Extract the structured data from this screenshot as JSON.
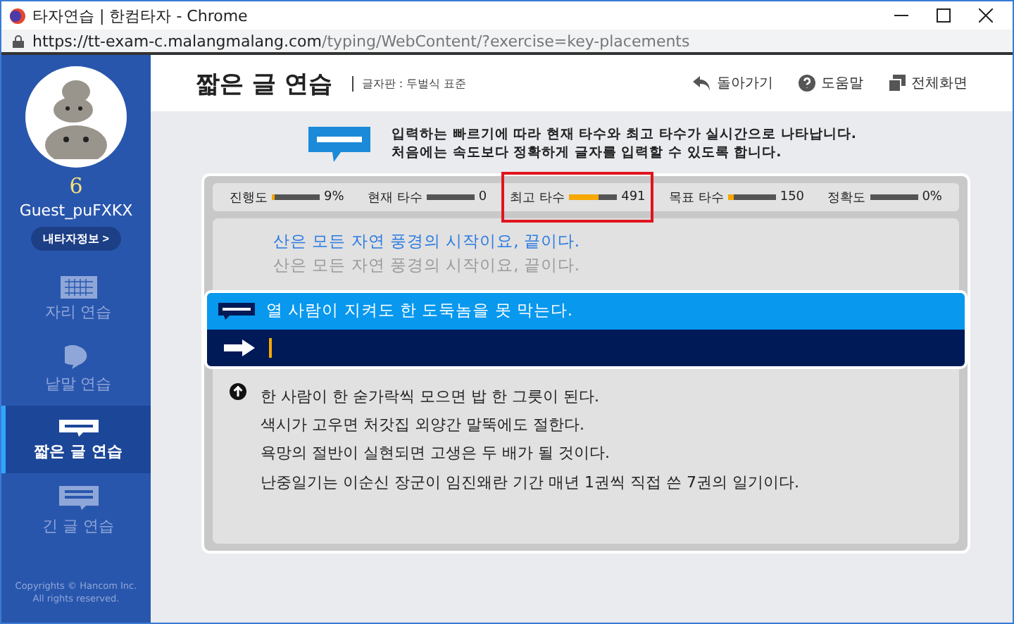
{
  "window": {
    "title": "타자연습 | 한컴타자 - Chrome",
    "url_host": "https://tt-exam-c.malangmalang.com",
    "url_path": "/typing/WebContent/?exercise=key-placements"
  },
  "profile": {
    "level": "6",
    "name": "Guest_puFXKX",
    "info_button": "내타자정보 >"
  },
  "sidebar": {
    "items": [
      {
        "label": "자리 연습",
        "kind": "keyboard",
        "selected": false
      },
      {
        "label": "낱말 연습",
        "kind": "chat",
        "selected": false
      },
      {
        "label": "짧은 글 연습",
        "kind": "short",
        "selected": true
      },
      {
        "label": "긴 글 연습",
        "kind": "long",
        "selected": false
      }
    ],
    "copyright": [
      "Copyrights © Hancom Inc.",
      "All rights reserved."
    ]
  },
  "header": {
    "title": "짧은 글 연습",
    "layout": "글자판 : 두벌식 표준",
    "actions": [
      {
        "label": "돌아가기",
        "kind": "back"
      },
      {
        "label": "도움말",
        "kind": "help"
      },
      {
        "label": "전체화면",
        "kind": "fullscreen"
      }
    ]
  },
  "notice": [
    "입력하는 빠르기에 따라 현재 타수와 최고 타수가 실시간으로 나타납니다.",
    "처음에는 속도보다 정확하게 글자를 입력할 수 있도록 합니다."
  ],
  "stats": [
    {
      "label": "진행도",
      "value": "9%",
      "level": 0.06,
      "highlighted": false
    },
    {
      "label": "현재 타수",
      "value": "0",
      "level": 0,
      "highlighted": false
    },
    {
      "label": "최고 타수",
      "value": "491",
      "level": 0.6,
      "highlighted": true
    },
    {
      "label": "목표 타수",
      "value": "150",
      "level": 0.12,
      "highlighted": false
    },
    {
      "label": "정확도",
      "value": "0%",
      "level": 0,
      "highlighted": false
    }
  ],
  "previous": {
    "typed": "산은 모든 자연 풍경의 시작이요, 끝이다.",
    "original": "산은 모든 자연 풍경의 시작이요, 끝이다."
  },
  "current": {
    "sentence": "열 사람이 지켜도 한 도둑놈을 못 막는다."
  },
  "upcoming": [
    "한 사람이 한 숟가락씩 모으면 밥 한 그릇이 된다.",
    "색시가 고우면 처갓집 외양간 말뚝에도 절한다.",
    "욕망의 절반이 실현되면 고생은 두 배가 될 것이다.",
    "난중일기는 이순신 장군이 임진왜란 기간 매년 1권씩 직접 쓴 7권의 일기이다."
  ]
}
